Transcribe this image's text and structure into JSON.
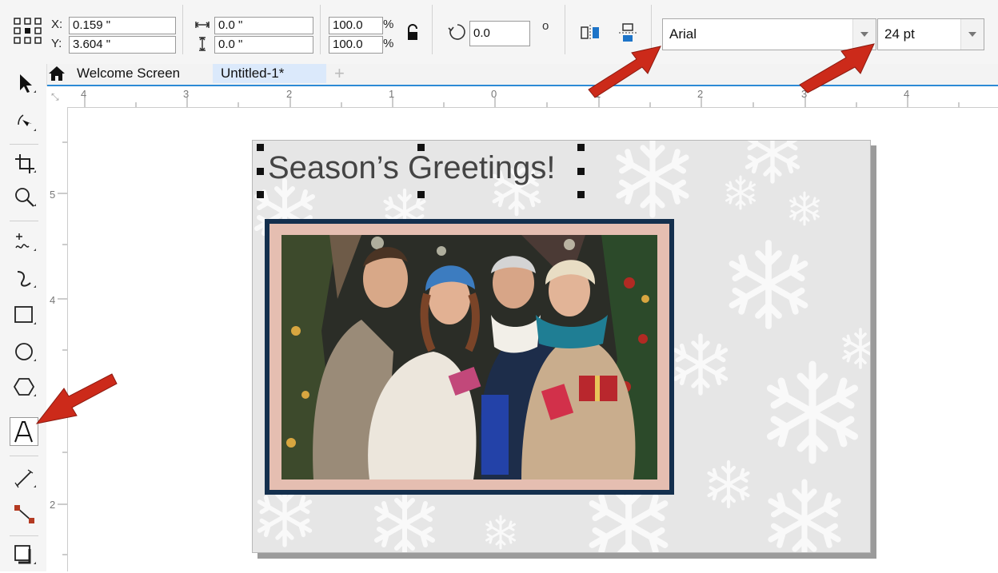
{
  "propbar": {
    "x_label": "X:",
    "x_value": "0.159 \"",
    "y_label": "Y:",
    "y_value": "3.604 \"",
    "width_value": "0.0 \"",
    "height_value": "0.0 \"",
    "scale_x": "100.0",
    "scale_y": "100.0",
    "percent_x": "%",
    "percent_y": "%",
    "rotation_value": "0.0",
    "degree_symbol": "o",
    "font_name": "Arial",
    "font_size": "24 pt"
  },
  "tabs": {
    "welcome": "Welcome Screen",
    "document": "Untitled-1*"
  },
  "rulers": {
    "horizontal": [
      "4",
      "3",
      "2",
      "1",
      "0",
      "1",
      "2",
      "3",
      "4"
    ],
    "vertical": [
      "5",
      "4",
      "2"
    ]
  },
  "document": {
    "greeting": "Season’s Greetings!"
  },
  "colors": {
    "arrow": "#cc2a1a",
    "frame": "#142f4d",
    "mat": "#e5beb1",
    "page": "#e6e6e6",
    "tab_accent": "#2d8ad6"
  }
}
